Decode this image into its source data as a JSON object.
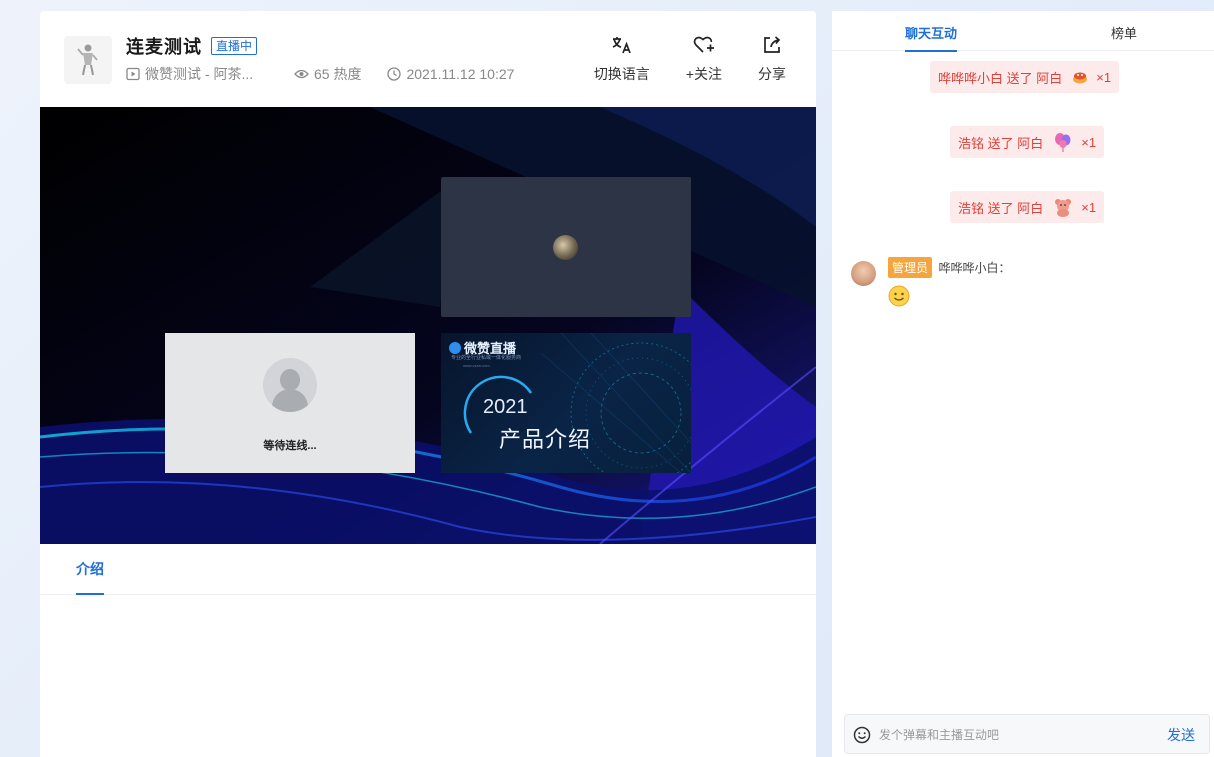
{
  "header": {
    "title": "连麦测试",
    "live_badge": "直播中",
    "room_name": "微赞测试 - 阿茶...",
    "views": "65 热度",
    "datetime": "2021.11.12 10:27"
  },
  "actions": [
    {
      "label": "切换语言",
      "icon": "translate-icon"
    },
    {
      "label": "+关注",
      "icon": "heart-plus-icon"
    },
    {
      "label": "分享",
      "icon": "share-icon"
    }
  ],
  "video": {
    "waiting_text": "等待连线...",
    "ppt": {
      "brand": "微赞直播",
      "tagline": "专业的全行业私域一体化服务商",
      "url": "www.vzan.com",
      "year": "2021",
      "title": "产品介绍"
    }
  },
  "content_tabs": [
    {
      "label": "介绍",
      "active": true
    }
  ],
  "chat": {
    "tabs": [
      {
        "label": "聊天互动",
        "active": true
      },
      {
        "label": "榜单",
        "active": false
      }
    ],
    "gifts": [
      {
        "text": "哗哗哗小白 送了 阿白",
        "gift_icon": "cake-gift-icon",
        "count": "×1"
      },
      {
        "text": "浩铭 送了 阿白",
        "gift_icon": "balloon-gift-icon",
        "count": "×1"
      },
      {
        "text": "浩铭 送了 阿白",
        "gift_icon": "teddy-bear-gift-icon",
        "count": "×1"
      }
    ],
    "message": {
      "badge": "管理员",
      "name": "哗哗哗小白：",
      "content_icon": "smile-emoji-icon"
    },
    "input_placeholder": "发个弹幕和主播互动吧",
    "send_label": "发送"
  },
  "colors": {
    "accent": "#1f6fd6",
    "gift_text": "#e0403a",
    "gift_bg": "#fdeaea",
    "admin_badge": "#f5a53c"
  }
}
